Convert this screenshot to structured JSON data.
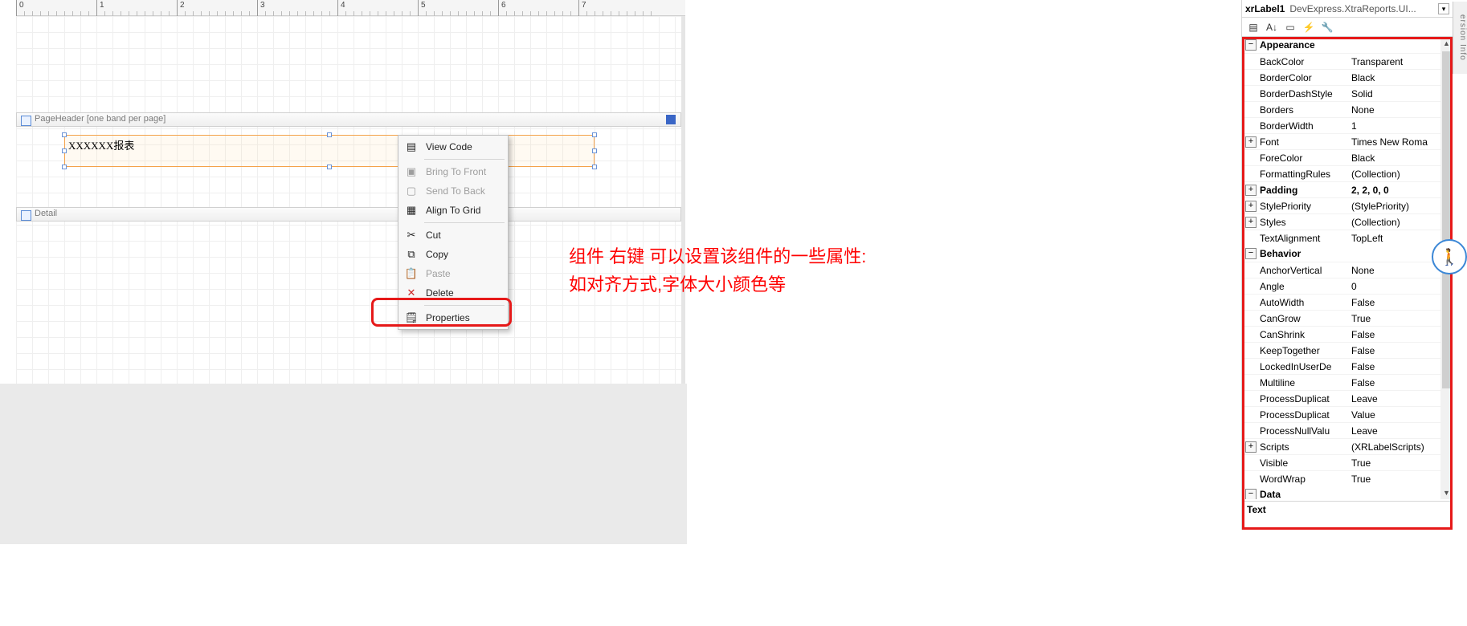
{
  "ruler": {
    "ticks": [
      0,
      1,
      2,
      3,
      4,
      5,
      6,
      7
    ]
  },
  "bands": {
    "pageHeader": "PageHeader [one band per page]",
    "detail": "Detail"
  },
  "label_text": "XXXXXX报表",
  "context_menu": {
    "view_code": "View Code",
    "bring_front": "Bring To Front",
    "send_back": "Send To Back",
    "align_grid": "Align To Grid",
    "cut": "Cut",
    "copy": "Copy",
    "paste": "Paste",
    "delete": "Delete",
    "properties": "Properties"
  },
  "annotation": {
    "line1": "组件 右键 可以设置该组件的一些属性:",
    "line2": "如对齐方式,字体大小颜色等"
  },
  "property_header": {
    "name": "xrLabel1",
    "type": "DevExpress.XtraReports.UI..."
  },
  "categories": {
    "appearance": "Appearance",
    "behavior": "Behavior",
    "data": "Data"
  },
  "props": {
    "BackColor": "Transparent",
    "BorderColor": "Black",
    "BorderDashStyle": "Solid",
    "Borders": "None",
    "BorderWidth": "1",
    "Font": "Times New Roma",
    "ForeColor": "Black",
    "FormattingRules": "(Collection)",
    "Padding": "2, 2, 0, 0",
    "StylePriority": "(StylePriority)",
    "Styles": "(Collection)",
    "TextAlignment": "TopLeft",
    "AnchorVertical": "None",
    "Angle": "0",
    "AutoWidth": "False",
    "CanGrow": "True",
    "CanShrink": "False",
    "KeepTogether": "False",
    "LockedInUserDe": "False",
    "Multiline": "False",
    "ProcessDuplicat1": "Leave",
    "ProcessDuplicat2": "Value",
    "ProcessNullValu": "Leave",
    "Scripts": "(XRLabelScripts)",
    "Visible": "True",
    "WordWrap": "True"
  },
  "desc_label": "Text",
  "side_tab": "ersion Info"
}
